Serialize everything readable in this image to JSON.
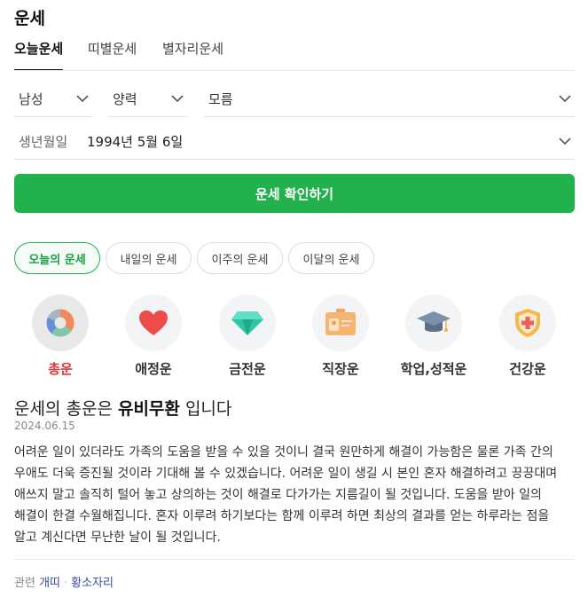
{
  "header": {
    "title": "운세"
  },
  "tabs": [
    {
      "label": "오늘운세",
      "active": true
    },
    {
      "label": "띠별운세",
      "active": false
    },
    {
      "label": "별자리운세",
      "active": false
    }
  ],
  "form": {
    "gender": "남성",
    "calendar": "양력",
    "birth_time": "모름",
    "birth_label": "생년월일",
    "birth_value": "1994년 5월 6일",
    "submit_label": "운세 확인하기"
  },
  "period_chips": [
    {
      "label": "오늘의 운세",
      "active": true
    },
    {
      "label": "내일의 운세",
      "active": false
    },
    {
      "label": "이주의 운세",
      "active": false
    },
    {
      "label": "이달의 운세",
      "active": false
    }
  ],
  "categories": [
    {
      "label": "총운",
      "icon": "donut-chart-icon",
      "active": true
    },
    {
      "label": "애정운",
      "icon": "heart-icon",
      "active": false
    },
    {
      "label": "금전운",
      "icon": "diamond-icon",
      "active": false
    },
    {
      "label": "직장운",
      "icon": "id-badge-icon",
      "active": false
    },
    {
      "label": "학업,성적운",
      "icon": "graduation-cap-icon",
      "active": false
    },
    {
      "label": "건강운",
      "icon": "health-shield-icon",
      "active": false
    }
  ],
  "result": {
    "headline_pre": "운세의 총운은",
    "headline_bold": "유비무환",
    "headline_post": "입니다",
    "date": "2024.06.15",
    "text": "어려운 일이 있더라도 가족의 도움을 받을 수 있을 것이니 결국 원만하게 해결이 가능함은 물론 가족 간의 우애도 더욱 증진될 것이라 기대해 볼 수 있겠습니다. 어려운 일이 생길 시 본인 혼자 해결하려고 끙끙대며 애쓰지 말고 솔직히 털어 놓고 상의하는 것이 해결로 다가가는 지름길이 될 것입니다. 도움을 받아 일의 해결이 한결 수월해집니다. 혼자 이루려 하기보다는 함께 이루려 하면 최상의 결과를 얻는 하루라는 점을 알고 계신다면 무난한 날이 될 것입니다."
  },
  "related": {
    "label": "관련",
    "links": [
      "개띠",
      "황소자리"
    ]
  },
  "colors": {
    "accent_green": "#22b14c",
    "active_red": "#e2363b",
    "link_blue": "#2f4f9e"
  }
}
